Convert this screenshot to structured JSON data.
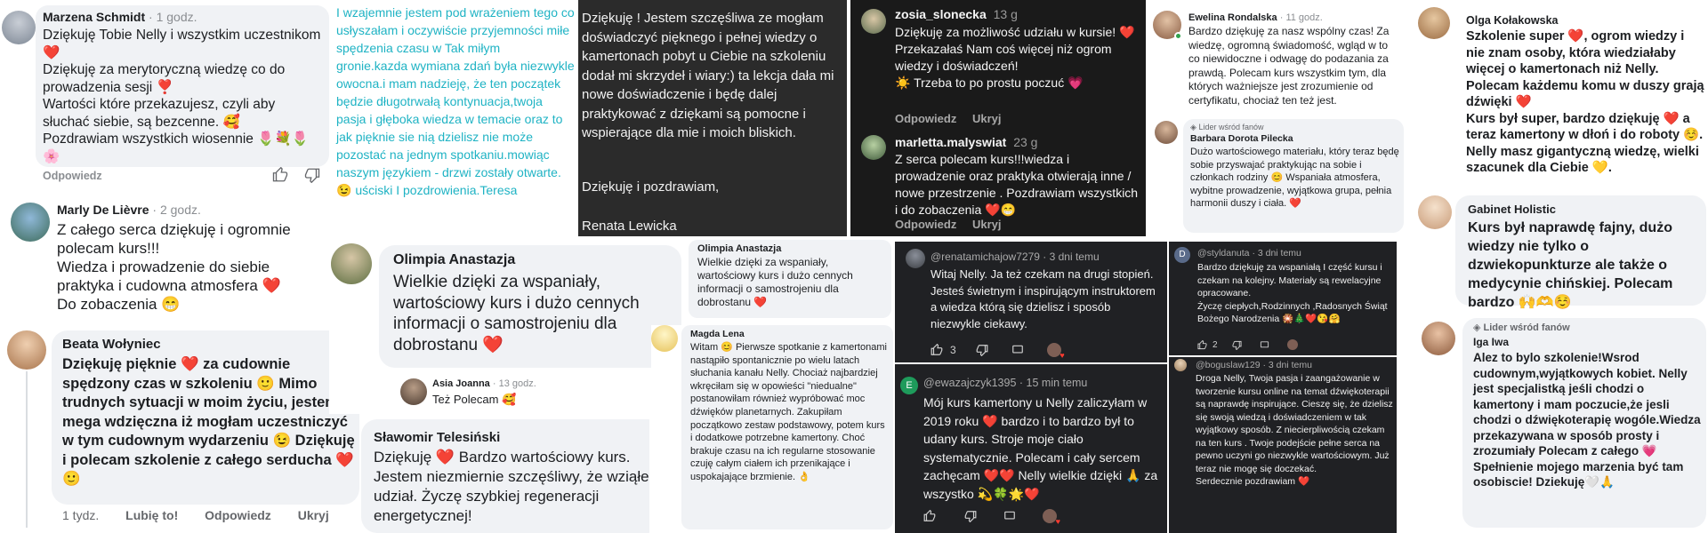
{
  "c1": {
    "author": "Marzena Schmidt",
    "time": "· 1 godz.",
    "text": "Dziękuję Tobie Nelly i wszystkim uczestnikom ❤️\nDziękuję za merytoryczną wiedzę  co do prowadzenia sesji ❣️\nWartości które przekazujesz, czyli aby słuchać siebie, są bezcenne. 🥰\nPozdrawiam wszystkich wiosennie 🌷💐🌷🌸",
    "action": "Odpowiedz"
  },
  "c2": {
    "text": "I wzajemnie jestem pod wrażeniem tego co usłyszałam i oczywiście przyjemności miłe spędzenia czasu w Tak miłym gronie.kazda wymiana zdań była niezwykle owocna.i mam nadzieję, że ten początek będzie długotrwałą kontynuacja,twoja pasja i głęboka wiedza w temacie oraz to jak pięknie sie nią dzielisz nie może pozostać na jednym spotkaniu.mowiąc naszym językiem - drzwi zostały otwarte.😉 uściski I pozdrowienia.Teresa"
  },
  "c3": {
    "text": "Dziękuję ! Jestem szczęśliwa ze mogłam doświadczyć pięknego i pełnej wiedzy o kamertonach pobyt u Ciebie na szkoleniu dodał mi skrzydeł i wiary:) ta lekcja dała mi nowe doświadczenie i będę dalej praktykować z dziękami są pomocne i wspierające dla mie i moich bliskich.",
    "greeting": "Dziękuję i pozdrawiam,",
    "signature": "Renata Lewicka"
  },
  "c4": {
    "author": "zosia_slonecka",
    "time": "13 g",
    "text": "Dziękuję za możliwość udziału w kursie! ❤️\nPrzekazałaś Nam coś więcej niż ogrom wiedzy i doświadczeń!\n☀️  Trzeba to po prostu poczuć 💗",
    "reply": "Odpowiedz",
    "hide": "Ukryj"
  },
  "c5": {
    "author": "marletta.malyswiat",
    "time": "23 g",
    "text": "Z serca polecam kurs!!!wiedza i prowadzenie oraz praktyka otwierają inne / nowe przestrzenie . Pozdrawiam wszystkich i do zobaczenia ❤️😁",
    "reply": "Odpowiedz",
    "hide": "Ukryj"
  },
  "c6": {
    "author": "Ewelina Rondalska",
    "time": "· 11 godz.",
    "text": "Bardzo dziękuję za nasz wspólny czas! Za wiedzę, ogromną świadomość, wgląd w to co niewidoczne i odwagę do podazania za prawdą. Polecam kurs wszystkim tym, dla których ważniejsze jest zrozumienie od certyfikatu, chociaż ten też jest."
  },
  "c7": {
    "badge": "Lider wśród fanów",
    "author": "Barbara Dorota Pilecka",
    "text": "Dużo wartościowego materiału, który teraz będę sobie przyswajać praktykując na sobie i członkach rodziny 😊 Wspaniała atmosfera, wybitne prowadzenie, wyjątkowa grupa, pełnia harmonii duszy i ciała. ❤️"
  },
  "c8": {
    "author": "Olga Kołakowska",
    "text": "Szkolenie super ❤️, ogrom wiedzy i nie znam osoby, która wiedziałaby więcej o kamertonach niż Nelly. Polecam każdemu komu w duszy grają dźwięki ❤️\nKurs był super, bardzo dziękuję ❤️ a teraz kamertony w dłoń i do roboty ☺️. Nelly masz gigantyczną wiedzę, wielki szacunek dla Ciebie 💛."
  },
  "c9": {
    "author": "Marly De Lièvre",
    "time": "· 2 godz.",
    "text": "Z całego serca dziękuję i ogromnie polecam kurs!!!\nWiedza i prowadzenie do siebie praktyka i cudowna atmosfera ❤️\nDo zobaczenia 😁"
  },
  "c10": {
    "author": "Olimpia Anastazja",
    "text": "Wielkie dzięki za wspaniały, wartościowy kurs i dużo cennych informacji o samostrojeniu dla dobrostanu ❤️"
  },
  "c11": {
    "author": "Asia Joanna",
    "time": "· 13 godz.",
    "text": "Też Polecam 🥰"
  },
  "c12": {
    "author": "Olimpia Anastazja",
    "text": "Wielkie dzięki za wspaniały, wartościowy kurs i dużo cennych informacji o samostrojeniu dla dobrostanu ❤️"
  },
  "c13": {
    "author": "Magda Lena",
    "text": "Witam 😊 Pierwsze spotkanie z kamertonami  nastąpiło spontanicznie po wielu latach słuchania kanału Nelly. Chociaż najbardziej wkręciłam się w opowieści \"niedualne\" postanowiłam również wypróbować moc dźwięków planetarnych. Zakupiłam początkowo zestaw podstawowy, potem kurs i dodatkowe potrzebne kamertony. Choć brakuje czasu na ich regularne stosowanie czuję całym ciałem ich przenikające i uspokajające brzmienie. 👌"
  },
  "c14": {
    "author": "@renatamichajow7279",
    "time": "· 3 dni temu",
    "text": "Witaj Nelly. Ja też czekam na drugi stopień. Jesteś świetnym i inspirującym instruktorem  a wiedza którą się dzielisz  i sposób niezwykle ciekawy.",
    "likes": "3"
  },
  "c15": {
    "author": "@styldanuta",
    "time": "· 3 dni temu",
    "initial": "D",
    "text": "Bardzo dziękuję za wspaniałą I część kursu i czekam na kolejny. Materiały są rewelacyjne opracowane.\nŻyczę ciepłych,Rodzinnych ,Radosnych Świąt Bożego Narodzenia 🎇🎄❤️😘🤗",
    "likes": "2"
  },
  "c16": {
    "author": "@ewazajczyk1395",
    "time": "· 15 min temu",
    "initial": "E",
    "text": "Mój kurs kamertony u Nelly zaliczyłam w 2019 roku ❤️ bardzo i to bardzo był to udany kurs. Stroje moje ciało systematycznie. Polecam i cały sercem zachęcam ❤️❤️ Nelly wielkie dzięki 🙏 za wszystko 💫🍀🌟❤️"
  },
  "c17": {
    "author": "@boguslaw129",
    "time": "· 3 dni temu",
    "text": "Droga Nelly, Twoja pasja i zaangażowanie w tworzenie kursu online na temat dźwiękoterapii są naprawdę inspirujące. Cieszę się, że dzielisz się swoją wiedzą i doświadczeniem w tak wyjątkowy sposób. Z niecierpliwością czekam na ten kurs . Twoje podejście pełne serca na pewno uczyni go niezwykle wartościowym. Już teraz nie mogę się doczekać.\nSerdecznie pozdrawiam ❤️"
  },
  "c18": {
    "author": "Beata Wołyniec",
    "text": "Dziękuję pięknie ❤️ za cudownie spędzony czas w szkoleniu 🙂 Mimo trudnych sytuacji w moim życiu, jestem mega wdzięczna iż mogłam uczestniczyć w tym cudownym wydarzeniu 😉 Dziękuję i polecam szkolenie z całego serducha ❤️🙂",
    "time": "1 tydz.",
    "like": "Lubię to!",
    "reply": "Odpowiedz",
    "hide": "Ukryj"
  },
  "c19": {
    "author": "Sławomir Telesiński",
    "text": "Dziękuję ❤️ Bardzo wartościowy kurs. Jestem niezmiernie szczęśliwy, że wziąłem udział. Życzę szybkiej regeneracji energetycznej!"
  },
  "c20": {
    "author": "Gabinet Holistic",
    "text": "Kurs był naprawdę fajny, dużo wiedzy nie tylko o dzwiekopunkturze ale także o medycynie chińskiej. Polecam bardzo 🙌🫶☺️"
  },
  "c21": {
    "badge": "Lider wśród fanów",
    "author": "Iga Iwa",
    "text": "Alez to bylo szkolenie!Wsrod cudownym,wyjątkowych kobiet. Nelly jest specjalistką jeśli chodzi o kamertony i mam poczucie,że jesli chodzi o dźwiękoterapię wogóle.Wiedza przekazywana w sposób prosty i zrozumiały Polecam z całego 💗Spełnienie mojego marzenia być tam osobiscie! Dziekuję🤍🙏"
  },
  "colors": {
    "fb_grey": "#f0f2f5",
    "teal_text": "#1fb3c4",
    "dark_tile": "#2b2b2b",
    "yt_dark": "#202124",
    "ig_dark": "#1a1a1a"
  }
}
